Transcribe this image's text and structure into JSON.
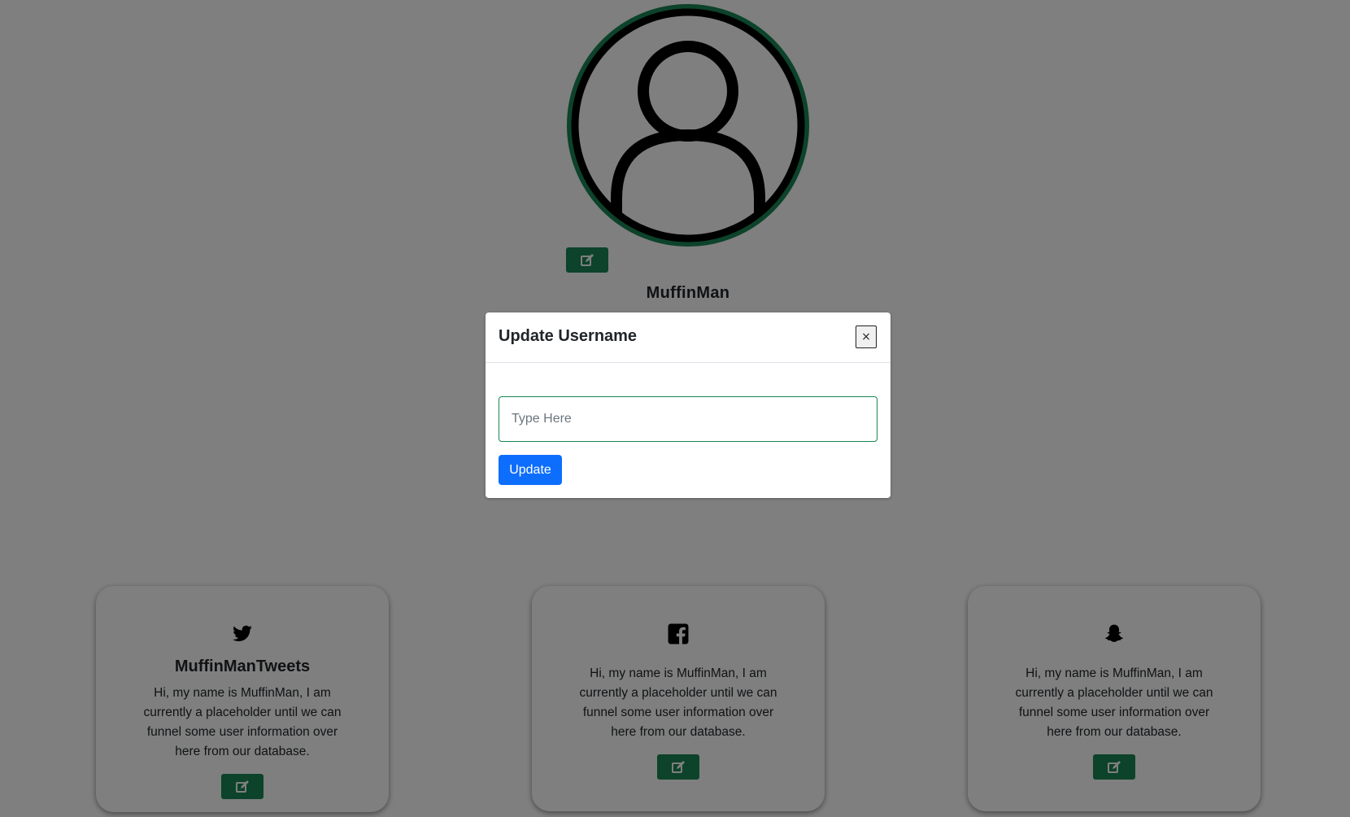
{
  "profile": {
    "avatar_icon": "user-icon",
    "edit_icon": "edit-icon",
    "username": "MuffinMan"
  },
  "cards": [
    {
      "icon": "twitter-icon",
      "title": "MuffinManTweets",
      "text": "Hi, my name is MuffinMan, I am currently a placeholder until we can funnel some user information over here from our database."
    },
    {
      "icon": "facebook-icon",
      "title": "",
      "text": "Hi, my name is MuffinMan, I am currently a placeholder until we can funnel some user information over here from our database."
    },
    {
      "icon": "snapchat-icon",
      "title": "",
      "text": "Hi, my name is MuffinMan, I am currently a placeholder until we can funnel some user information over here from our database."
    }
  ],
  "modal": {
    "title": "Update Username",
    "close_label": "×",
    "input_placeholder": "Type Here",
    "input_value": "",
    "submit_label": "Update"
  },
  "colors": {
    "edit_button": "#198754",
    "avatar_ring": "#198754",
    "primary_button": "#0d6efd",
    "backdrop": "rgba(0,0,0,0.5)"
  }
}
